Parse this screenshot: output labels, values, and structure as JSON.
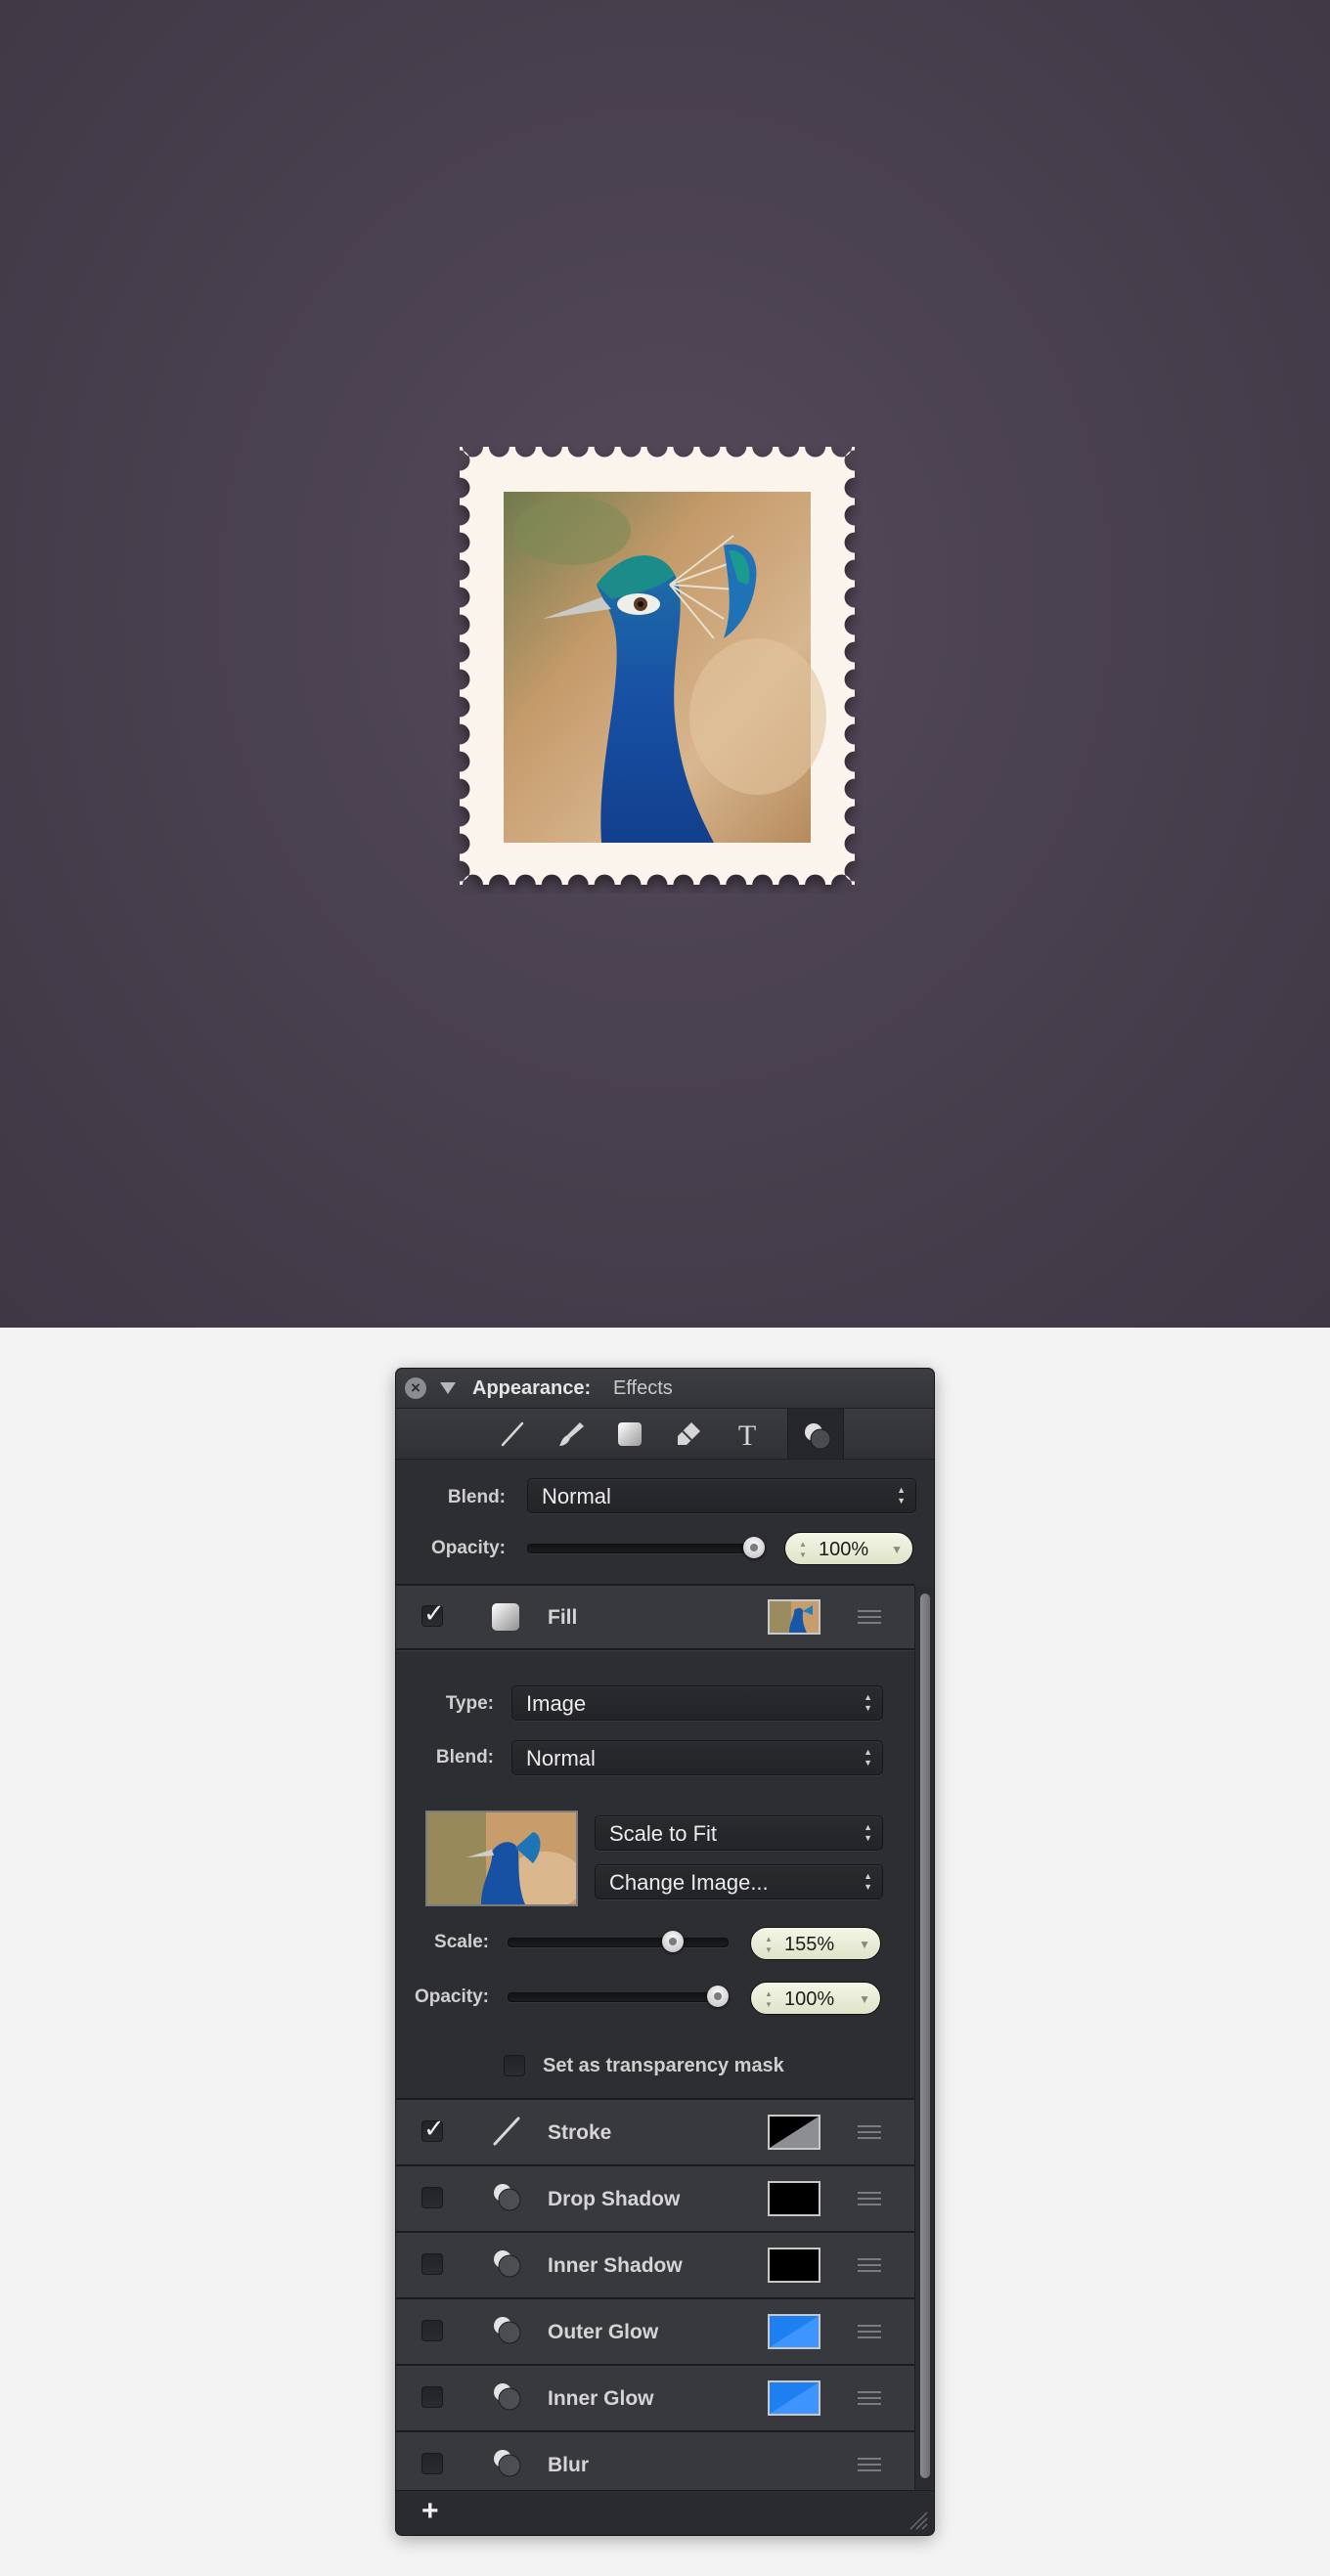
{
  "panel": {
    "title": "Appearance:",
    "subtitle": "Effects",
    "blend_label": "Blend:",
    "blend_value": "Normal",
    "opacity_label": "Opacity:",
    "opacity_value": "100%",
    "opacity_level": 1.0
  },
  "toolbar": {
    "tools": [
      "line-icon",
      "brush-icon",
      "fill-icon",
      "eraser-icon",
      "text-icon",
      "effects-icon"
    ],
    "active": "effects-icon"
  },
  "fill": {
    "label": "Fill",
    "checked": true,
    "type_label": "Type:",
    "type_value": "Image",
    "blend_label": "Blend:",
    "blend_value": "Normal",
    "fit_value": "Scale to Fit",
    "change_image": "Change Image...",
    "scale_label": "Scale:",
    "scale_value": "155%",
    "scale_level": 0.78,
    "opacity_label": "Opacity:",
    "opacity_value": "100%",
    "opacity_level": 1.0,
    "mask_label": "Set as transparency mask"
  },
  "effects": [
    {
      "label": "Stroke",
      "checked": true,
      "icon": "stroke-icon",
      "swatch": "gray-diagonal"
    },
    {
      "label": "Drop Shadow",
      "checked": false,
      "icon": "shadow-icon",
      "swatch": "black"
    },
    {
      "label": "Inner Shadow",
      "checked": false,
      "icon": "shadow-icon",
      "swatch": "black"
    },
    {
      "label": "Outer Glow",
      "checked": false,
      "icon": "shadow-icon",
      "swatch": "blue"
    },
    {
      "label": "Inner Glow",
      "checked": false,
      "icon": "shadow-icon",
      "swatch": "blue"
    },
    {
      "label": "Blur",
      "checked": false,
      "icon": "shadow-icon",
      "swatch": "none"
    }
  ],
  "footer": {
    "add_label": "+"
  },
  "colors": {
    "canvas": "#4a4150",
    "stamp_paper": "#fbf4ec",
    "panel": "#2d2e31",
    "glow_blue": "#1e7ff0"
  }
}
